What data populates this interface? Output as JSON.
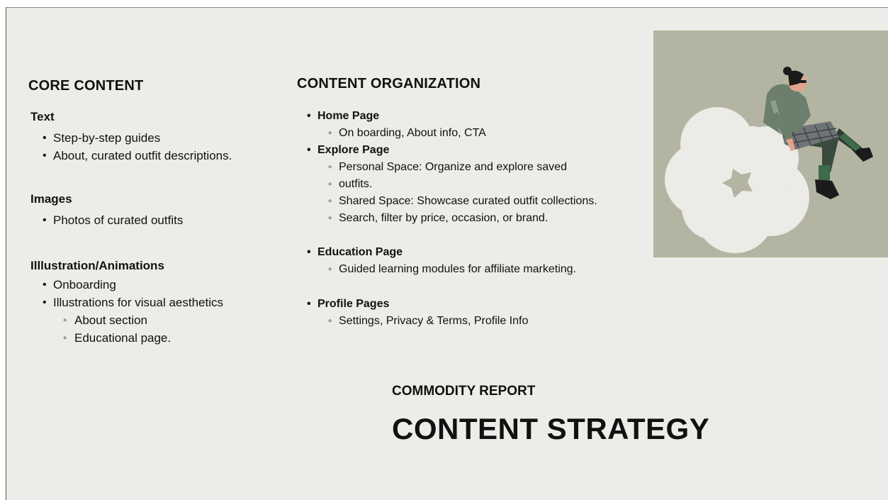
{
  "core_content": {
    "heading": "CORE CONTENT",
    "text": {
      "title": "Text",
      "items": [
        "Step-by-step guides",
        "About, curated outfit descriptions."
      ]
    },
    "images": {
      "title": "Images",
      "items": [
        "Photos of curated outfits"
      ]
    },
    "illustration": {
      "title": "Illlustration/Animations",
      "items": [
        "Onboarding",
        "Illustrations for visual aesthetics"
      ],
      "subitems": [
        "About section",
        "Educational page."
      ]
    }
  },
  "content_organization": {
    "heading": "CONTENT ORGANIZATION",
    "home": {
      "title": "Home Page",
      "subitems": [
        "On boarding, About info, CTA"
      ]
    },
    "explore": {
      "title": "Explore Page",
      "subitems": [
        "Personal Space: Organize and explore saved",
        "outfits.",
        "Shared Space: Showcase curated outfit collections.",
        "Search",
        ", filter by price, occasion, or brand."
      ]
    },
    "education": {
      "title": "Education Page",
      "subitems": [
        "Guided learning modules for affiliate marketing."
      ]
    },
    "profile": {
      "title": "Profile Pages",
      "subitems": [
        "Settings, Privacy & Terms, Profile Info"
      ]
    }
  },
  "footer": {
    "kicker": "COMMODITY REPORT",
    "headline": "CONTENT STRATEGY"
  },
  "illustration_panel": {
    "background": "#b4b4a2",
    "cloud_color": "#ecebe7",
    "icon": "person-sitting-on-flower-illustration"
  }
}
